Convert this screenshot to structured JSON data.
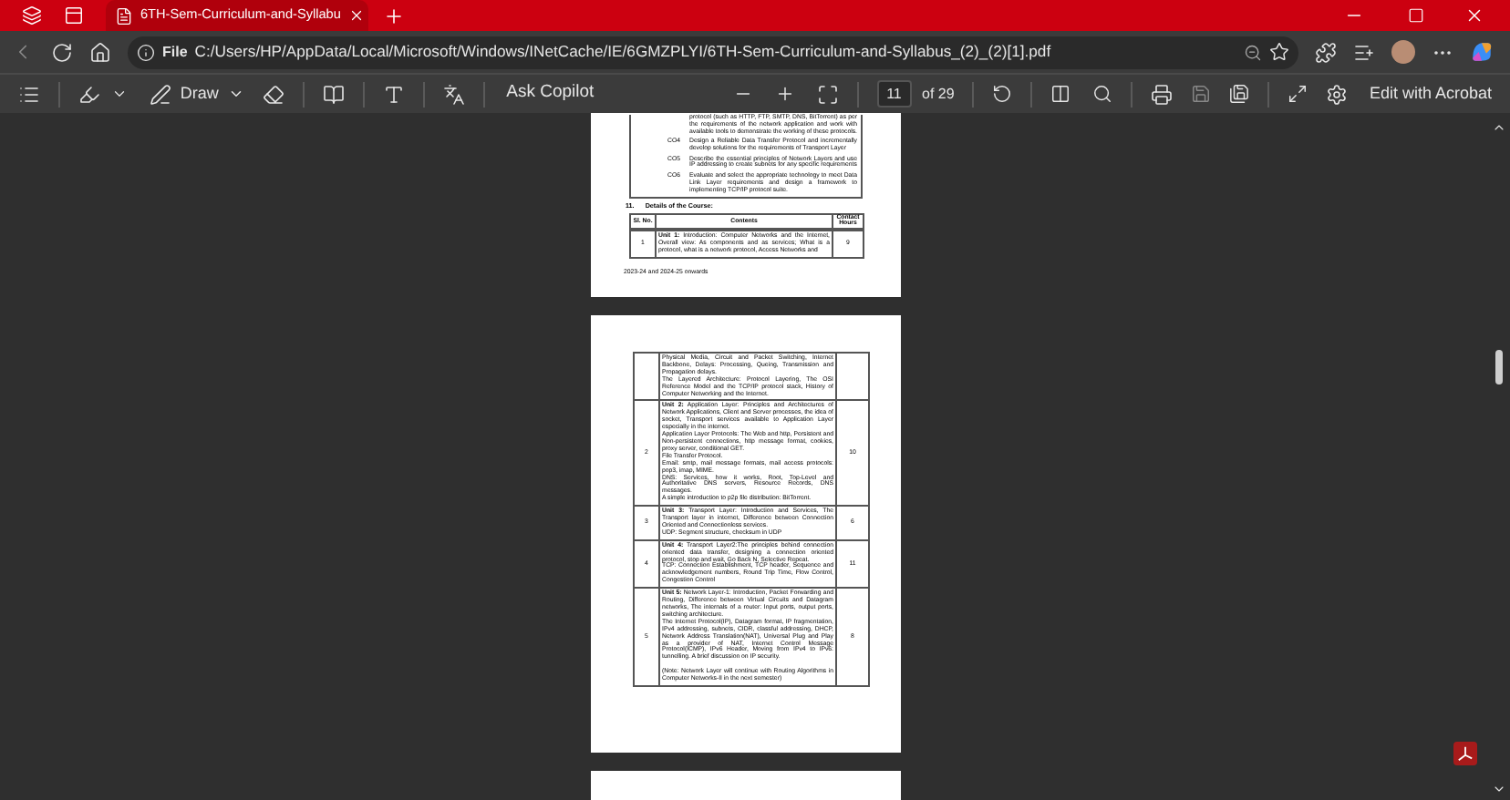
{
  "browser": {
    "tabs": [
      {
        "title": "6TH-Sem-Curriculum-and-Syllabu",
        "selected": true
      }
    ],
    "address": {
      "scheme_label": "File",
      "url": "C:/Users/HP/AppData/Local/Microsoft/Windows/INetCache/IE/6GMZPLYI/6TH-Sem-Curriculum-and-Syllabus_(2)_(2)[1].pdf"
    }
  },
  "pdf_toolbar": {
    "draw_label": "Draw",
    "copilot_label": "Ask Copilot",
    "page_number": "11",
    "page_count": "of 29",
    "acrobat_label": "Edit with Acrobat"
  },
  "pages": [
    {
      "outcomes": [
        {
          "text": "protocol (such as HTTP, FTP, SMTP, DNS, BitTorrent) as per the requirements of the network application and work with available tools to demonstrate the working of these protocols."
        },
        {
          "code": "CO4",
          "text": "Design a Reliable Data Transfer Protocol and incrementally develop solutions for the requirements of Transport Layer"
        },
        {
          "code": "CO5",
          "text": "Describe the essential principles of Network Layers and use IP addressing to create subnets for any specific requirements"
        },
        {
          "code": "CO6",
          "text": "Evaluate and select the appropriate technology to meet Data Link Layer requirements and design a framework to implementing TCP/IP protocol suite."
        }
      ],
      "section_number": "11.",
      "section_title": "Details of the Course:",
      "columns": [
        "Sl. No.",
        "Contents",
        "Contact Hours"
      ],
      "rows": [
        {
          "number": "1",
          "content": "**Unit 1:** Introduction: Computer Networks and the Internet, Overall view: As components and as services; What is a protocol, what is a network protocol, Access Networks and",
          "hours": "9"
        }
      ],
      "footer": "2023-24 and 2024-25 onwards"
    },
    {
      "rows": [
        {
          "content": "Physical Media, Circuit and Packet Switching, Internet Backbone, Delays: Processing, Queing, Transmission and Propagation delays.\nThe Layered Architecture: Protocol Layering, The OSI Reference Model and the TCP/IP protocol stack, History of Computer Networking and the Internet."
        },
        {
          "number": "2",
          "content": "**Unit 2:** Application Layer: Principles and Architectures of Network Applications, Client and Server processes, the idea of socket, Transport services available to Application Layer especially in the internet.\nApplication Layer Protocols: The Web and http, Persistent and Non-persistent connections, http message format, cookies, proxy server, conditional GET.\nFile Transfer Protocol.\nEmail: smtp, mail message formats, mail access protocols: pop3, imap, MIME.\nDNS: Services, how it works, Root, Top-Level and Authoritative DNS servers, Resource Records, DNS messages.\nA simple introduction to p2p file distribution: BitTorrent.",
          "hours": "10"
        },
        {
          "number": "3",
          "content": "**Unit 3:** Transport Layer: Introduction and Services, The Transport layer in internet, Difference between Connection Oriented and Connectionless services.\nUDP: Segment structure, checksum in UDP",
          "hours": "6"
        },
        {
          "number": "4",
          "content": "**Unit 4:** Transport Layer2:The principles behind connection oriented data transfer, designing a connection oriented protocol, stop and wait, Go Back N, Selective Repeat.\nTCP: Connection Establishment, TCP header, Sequence and acknowledgement numbers, Round Trip Time, Flow Control, Congestion Control",
          "hours": "11"
        },
        {
          "number": "5",
          "content": "**Unit 5:** Network Layer-1: Introduction, Packet Forwarding and Routing, Difference between Virtual Circuits and Datagram networks, The internals of a router: Input ports, output ports, switching architecture.\nThe Internet Protocol(IP), Datagram format, IP fragmentation, IPv4 addressing, subnets, CIDR, classful addressing, DHCP, Network Address Translation(NAT), Universal Plug and Play as a provider of NAT, Internet Control Message Protocol(ICMP), IPv6 Header, Moving from IPv4 to IPv6: tunnelling. A brief discussion on IP security.\n\n(Note: Network Layer will continue with Routing Algorithms in Computer Networks-II in the next semester)",
          "hours": "8"
        }
      ]
    }
  ]
}
